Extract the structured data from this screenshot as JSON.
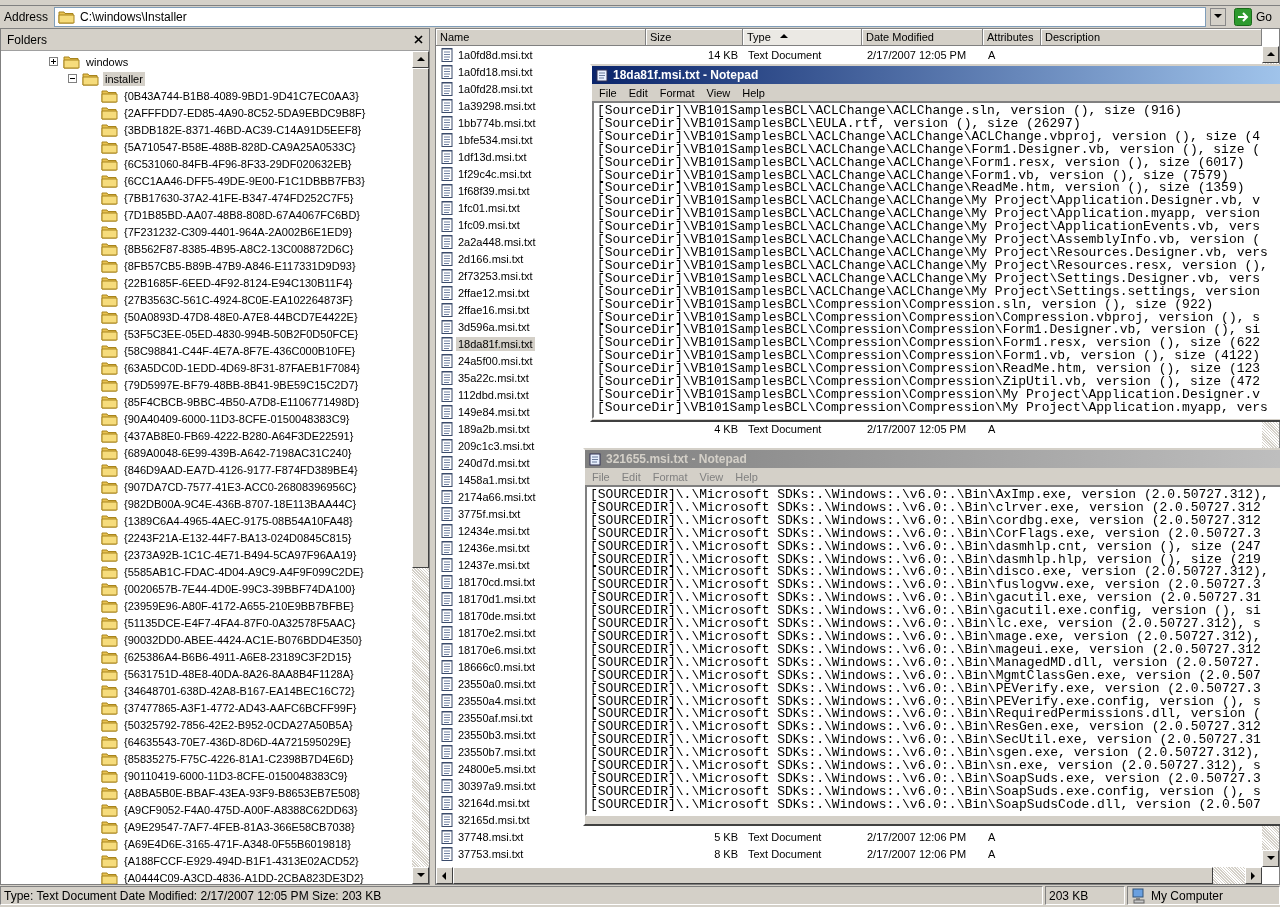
{
  "address_bar": {
    "label": "Address",
    "value": "C:\\windows\\Installer",
    "go_label": "Go"
  },
  "folders_pane": {
    "title": "Folders",
    "tree": [
      {
        "label": "windows",
        "expanded": false,
        "selected": false,
        "children": [
          {
            "label": "installer",
            "expanded": true,
            "selected": true,
            "children": [
              {
                "label": "{0B43A744-B1B8-4089-9BD1-9D41C7EC0AA3}",
                "selected": false
              },
              {
                "label": "{2AFFFDD7-ED85-4A90-8C52-5DA9EBDC9B8F}",
                "selected": false
              },
              {
                "label": "{3BDB182E-8371-46BD-AC39-C14A91D5EEF8}",
                "selected": false
              },
              {
                "label": "{5A710547-B58E-488B-828D-CA9A25A0533C}",
                "selected": false
              },
              {
                "label": "{6C531060-84FB-4F96-8F33-29DF020632EB}",
                "selected": false
              },
              {
                "label": "{6CC1AA46-DFF5-49DE-9E00-F1C1DBBB7FB3}",
                "selected": false
              },
              {
                "label": "{7BB17630-37A2-41FE-B347-474FD252C7F5}",
                "selected": false
              },
              {
                "label": "{7D1B85BD-AA07-48B8-808D-67A4067FC6BD}",
                "selected": false
              },
              {
                "label": "{7F231232-C309-4401-964A-2A002B6E1ED9}",
                "selected": false
              },
              {
                "label": "{8B562F87-8385-4B95-A8C2-13C008872D6C}",
                "selected": false
              },
              {
                "label": "{8FB57CB5-B89B-47B9-A846-E117331D9D93}",
                "selected": false
              },
              {
                "label": "{22B1685F-6EED-4F92-8124-E94C130B11F4}",
                "selected": false
              },
              {
                "label": "{27B3563C-561C-4924-8C0E-EA102264873F}",
                "selected": false
              },
              {
                "label": "{50A0893D-47D8-48E0-A7E8-44BCD7E4422E}",
                "selected": false
              },
              {
                "label": "{53F5C3EE-05ED-4830-994B-50B2F0D50FCE}",
                "selected": false
              },
              {
                "label": "{58C98841-C44F-4E7A-8F7E-436C000B10FE}",
                "selected": false
              },
              {
                "label": "{63A5DC0D-1EDD-4D69-8F31-87FAEB1F7084}",
                "selected": false
              },
              {
                "label": "{79D5997E-BF79-48BB-8B41-9BE59C15C2D7}",
                "selected": false
              },
              {
                "label": "{85F4CBCB-9BBC-4B50-A7D8-E1106771498D}",
                "selected": false
              },
              {
                "label": "{90A40409-6000-11D3-8CFE-0150048383C9}",
                "selected": false
              },
              {
                "label": "{437AB8E0-FB69-4222-B280-A64F3DE22591}",
                "selected": false
              },
              {
                "label": "{689A0048-6E99-439B-A642-7198AC31C240}",
                "selected": false
              },
              {
                "label": "{846D9AAD-EA7D-4126-9177-F874FD389BE4}",
                "selected": false
              },
              {
                "label": "{907DA7CD-7577-41E3-ACC0-26808396956C}",
                "selected": false
              },
              {
                "label": "{982DB00A-9C4E-436B-8707-18E113BAA44C}",
                "selected": false
              },
              {
                "label": "{1389C6A4-4965-4AEC-9175-08B54A10FA48}",
                "selected": false
              },
              {
                "label": "{2243F21A-E132-44F7-BA13-024D0845C815}",
                "selected": false
              },
              {
                "label": "{2373A92B-1C1C-4E71-B494-5CA97F96AA19}",
                "selected": false
              },
              {
                "label": "{5585AB1C-FDAC-4D04-A9C9-A4F9F099C2DE}",
                "selected": false
              },
              {
                "label": "{0020657B-7E44-4D0E-99C3-39BBF74DA100}",
                "selected": false
              },
              {
                "label": "{23959E96-A80F-4172-A655-210E9BB7BFBE}",
                "selected": false
              },
              {
                "label": "{51135DCE-E4F7-4FA4-87F0-0A32578F5AAC}",
                "selected": false
              },
              {
                "label": "{90032DD0-ABEE-4424-AC1E-B076BDD4E350}",
                "selected": false
              },
              {
                "label": "{625386A4-B6B6-4911-A6E8-23189C3F2D15}",
                "selected": false
              },
              {
                "label": "{5631751D-48E8-40DA-8A26-8AA8B4F1128A}",
                "selected": false
              },
              {
                "label": "{34648701-638D-42A8-B167-EA14BEC16C72}",
                "selected": false
              },
              {
                "label": "{37477865-A3F1-4772-AD43-AAFC6BCFF99F}",
                "selected": false
              },
              {
                "label": "{50325792-7856-42E2-B952-0CDA27A50B5A}",
                "selected": false
              },
              {
                "label": "{64635543-70E7-436D-8D6D-4A721595029E}",
                "selected": false
              },
              {
                "label": "{85835275-F75C-4226-81A1-C2398B7D4E6D}",
                "selected": false
              },
              {
                "label": "{90110419-6000-11D3-8CFE-0150048383C9}",
                "selected": false
              },
              {
                "label": "{A8BA5B0E-BBAF-43EA-93F9-B8653EB7E508}",
                "selected": false
              },
              {
                "label": "{A9CF9052-F4A0-475D-A00F-A8388C62DD63}",
                "selected": false
              },
              {
                "label": "{A9E29547-7AF7-4FEB-81A3-366E58CB7038}",
                "selected": false
              },
              {
                "label": "{A69E4D6E-3165-471F-A348-0F55B6019818}",
                "selected": false
              },
              {
                "label": "{A188FCCF-E929-494D-B1F1-4313E02ACD52}",
                "selected": false
              },
              {
                "label": "{A0444C09-A3CD-4836-A1DD-2CBA823DE3D2}",
                "selected": false
              }
            ]
          }
        ]
      }
    ]
  },
  "file_list": {
    "columns": [
      {
        "label": "Name",
        "sorted": false
      },
      {
        "label": "Size",
        "sorted": false
      },
      {
        "label": "Type",
        "sorted": true
      },
      {
        "label": "Date Modified",
        "sorted": false
      },
      {
        "label": "Attributes",
        "sorted": false
      },
      {
        "label": "Description",
        "sorted": false
      }
    ],
    "rows": [
      {
        "name": "1a0fd8d.msi.txt",
        "selected": false,
        "size": "14 KB",
        "type": "Text Document",
        "modified": "2/17/2007 12:05 PM",
        "attributes": "A"
      },
      {
        "name": "1a0fd18.msi.txt",
        "selected": false
      },
      {
        "name": "1a0fd28.msi.txt",
        "selected": false
      },
      {
        "name": "1a39298.msi.txt",
        "selected": false
      },
      {
        "name": "1bb774b.msi.txt",
        "selected": false
      },
      {
        "name": "1bfe534.msi.txt",
        "selected": false
      },
      {
        "name": "1df13d.msi.txt",
        "selected": false
      },
      {
        "name": "1f29c4c.msi.txt",
        "selected": false
      },
      {
        "name": "1f68f39.msi.txt",
        "selected": false
      },
      {
        "name": "1fc01.msi.txt",
        "selected": false
      },
      {
        "name": "1fc09.msi.txt",
        "selected": false
      },
      {
        "name": "2a2a448.msi.txt",
        "selected": false
      },
      {
        "name": "2d166.msi.txt",
        "selected": false
      },
      {
        "name": "2f73253.msi.txt",
        "selected": false
      },
      {
        "name": "2ffae12.msi.txt",
        "selected": false
      },
      {
        "name": "2ffae16.msi.txt",
        "selected": false
      },
      {
        "name": "3d596a.msi.txt",
        "selected": false
      },
      {
        "name": "18da81f.msi.txt",
        "selected": true
      },
      {
        "name": "24a5f00.msi.txt",
        "selected": false
      },
      {
        "name": "35a22c.msi.txt",
        "selected": false
      },
      {
        "name": "112dbd.msi.txt",
        "selected": false
      },
      {
        "name": "149e84.msi.txt",
        "selected": false
      },
      {
        "name": "189a2b.msi.txt",
        "selected": false,
        "size": "4 KB",
        "type": "Text Document",
        "modified": "2/17/2007 12:05 PM",
        "attributes": "A"
      },
      {
        "name": "209c1c3.msi.txt",
        "selected": false
      },
      {
        "name": "240d7d.msi.txt",
        "selected": false
      },
      {
        "name": "1458a1.msi.txt",
        "selected": false
      },
      {
        "name": "2174a66.msi.txt",
        "selected": false
      },
      {
        "name": "3775f.msi.txt",
        "selected": false
      },
      {
        "name": "12434e.msi.txt",
        "selected": false
      },
      {
        "name": "12436e.msi.txt",
        "selected": false
      },
      {
        "name": "12437e.msi.txt",
        "selected": false
      },
      {
        "name": "18170cd.msi.txt",
        "selected": false
      },
      {
        "name": "18170d1.msi.txt",
        "selected": false
      },
      {
        "name": "18170de.msi.txt",
        "selected": false
      },
      {
        "name": "18170e2.msi.txt",
        "selected": false
      },
      {
        "name": "18170e6.msi.txt",
        "selected": false
      },
      {
        "name": "18666c0.msi.txt",
        "selected": false
      },
      {
        "name": "23550a0.msi.txt",
        "selected": false
      },
      {
        "name": "23550a4.msi.txt",
        "selected": false
      },
      {
        "name": "23550af.msi.txt",
        "selected": false
      },
      {
        "name": "23550b3.msi.txt",
        "selected": false
      },
      {
        "name": "23550b7.msi.txt",
        "selected": false
      },
      {
        "name": "24800e5.msi.txt",
        "selected": false
      },
      {
        "name": "30397a9.msi.txt",
        "selected": false
      },
      {
        "name": "32164d.msi.txt",
        "selected": false
      },
      {
        "name": "32165d.msi.txt",
        "selected": false
      },
      {
        "name": "37748.msi.txt",
        "selected": false,
        "size": "5 KB",
        "type": "Text Document",
        "modified": "2/17/2007 12:06 PM",
        "attributes": "A"
      },
      {
        "name": "37753.msi.txt",
        "selected": false,
        "size": "8 KB",
        "type": "Text Document",
        "modified": "2/17/2007 12:06 PM",
        "attributes": "A"
      }
    ]
  },
  "notepads": [
    {
      "title": "18da81f.msi.txt - Notepad",
      "active": true,
      "menu": [
        "File",
        "Edit",
        "Format",
        "View",
        "Help"
      ],
      "lines": [
        "[SourceDir]\\VB101SamplesBCL\\ACLChange\\ACLChange.sln, version (), size (916)",
        "[SourceDir]\\VB101SamplesBCL\\EULA.rtf, version (), size (26297)",
        "[SourceDir]\\VB101SamplesBCL\\ACLChange\\ACLChange\\ACLChange.vbproj, version (), size (4",
        "[SourceDir]\\VB101SamplesBCL\\ACLChange\\ACLChange\\Form1.Designer.vb, version (), size (",
        "[SourceDir]\\VB101SamplesBCL\\ACLChange\\ACLChange\\Form1.resx, version (), size (6017)",
        "[SourceDir]\\VB101SamplesBCL\\ACLChange\\ACLChange\\Form1.vb, version (), size (7579)",
        "[SourceDir]\\VB101SamplesBCL\\ACLChange\\ACLChange\\ReadMe.htm, version (), size (1359)",
        "[SourceDir]\\VB101SamplesBCL\\ACLChange\\ACLChange\\My Project\\Application.Designer.vb, v",
        "[SourceDir]\\VB101SamplesBCL\\ACLChange\\ACLChange\\My Project\\Application.myapp, version",
        "[SourceDir]\\VB101SamplesBCL\\ACLChange\\ACLChange\\My Project\\ApplicationEvents.vb, vers",
        "[SourceDir]\\VB101SamplesBCL\\ACLChange\\ACLChange\\My Project\\AssemblyInfo.vb, version (",
        "[SourceDir]\\VB101SamplesBCL\\ACLChange\\ACLChange\\My Project\\Resources.Designer.vb, vers",
        "[SourceDir]\\VB101SamplesBCL\\ACLChange\\ACLChange\\My Project\\Resources.resx, version (),",
        "[SourceDir]\\VB101SamplesBCL\\ACLChange\\ACLChange\\My Project\\Settings.Designer.vb, vers",
        "[SourceDir]\\VB101SamplesBCL\\ACLChange\\ACLChange\\My Project\\Settings.settings, version",
        "[SourceDir]\\VB101SamplesBCL\\Compression\\Compression.sln, version (), size (922)",
        "[SourceDir]\\VB101SamplesBCL\\Compression\\Compression\\Compression.vbproj, version (), s",
        "[SourceDir]\\VB101SamplesBCL\\Compression\\Compression\\Form1.Designer.vb, version (), si",
        "[SourceDir]\\VB101SamplesBCL\\Compression\\Compression\\Form1.resx, version (), size (622",
        "[SourceDir]\\VB101SamplesBCL\\Compression\\Compression\\Form1.vb, version (), size (4122)",
        "[SourceDir]\\VB101SamplesBCL\\Compression\\Compression\\ReadMe.htm, version (), size (123",
        "[SourceDir]\\VB101SamplesBCL\\Compression\\Compression\\ZipUtil.vb, version (), size (472",
        "[SourceDir]\\VB101SamplesBCL\\Compression\\Compression\\My Project\\Application.Designer.v",
        "[SourceDir]\\VB101SamplesBCL\\Compression\\Compression\\My Project\\Application.myapp, vers"
      ]
    },
    {
      "title": "321655.msi.txt - Notepad",
      "active": false,
      "menu": [
        "File",
        "Edit",
        "Format",
        "View",
        "Help"
      ],
      "lines": [
        "[SOURCEDIR]\\.\\Microsoft SDKs:.\\Windows:.\\v6.0:.\\Bin\\AxImp.exe, version (2.0.50727.312),",
        "[SOURCEDIR]\\.\\Microsoft SDKs:.\\Windows:.\\v6.0:.\\Bin\\clrver.exe, version (2.0.50727.312",
        "[SOURCEDIR]\\.\\Microsoft SDKs:.\\Windows:.\\v6.0:.\\Bin\\cordbg.exe, version (2.0.50727.312",
        "[SOURCEDIR]\\.\\Microsoft SDKs:.\\Windows:.\\v6.0:.\\Bin\\CorFlags.exe, version (2.0.50727.3",
        "[SOURCEDIR]\\.\\Microsoft SDKs:.\\Windows:.\\v6.0:.\\Bin\\dasmhlp.cnt, version (), size (247",
        "[SOURCEDIR]\\.\\Microsoft SDKs:.\\Windows:.\\v6.0:.\\Bin\\dasmhlp.hlp, version (), size (219",
        "[SOURCEDIR]\\.\\Microsoft SDKs:.\\Windows:.\\v6.0:.\\Bin\\disco.exe, version (2.0.50727.312),",
        "[SOURCEDIR]\\.\\Microsoft SDKs:.\\Windows:.\\v6.0:.\\Bin\\fuslogvw.exe, version (2.0.50727.3",
        "[SOURCEDIR]\\.\\Microsoft SDKs:.\\Windows:.\\v6.0:.\\Bin\\gacutil.exe, version (2.0.50727.31",
        "[SOURCEDIR]\\.\\Microsoft SDKs:.\\Windows:.\\v6.0:.\\Bin\\gacutil.exe.config, version (), si",
        "[SOURCEDIR]\\.\\Microsoft SDKs:.\\Windows:.\\v6.0:.\\Bin\\lc.exe, version (2.0.50727.312), s",
        "[SOURCEDIR]\\.\\Microsoft SDKs:.\\Windows:.\\v6.0:.\\Bin\\mage.exe, version (2.0.50727.312),",
        "[SOURCEDIR]\\.\\Microsoft SDKs:.\\Windows:.\\v6.0:.\\Bin\\mageui.exe, version (2.0.50727.312",
        "[SOURCEDIR]\\.\\Microsoft SDKs:.\\Windows:.\\v6.0:.\\Bin\\ManagedMD.dll, version (2.0.50727.",
        "[SOURCEDIR]\\.\\Microsoft SDKs:.\\Windows:.\\v6.0:.\\Bin\\MgmtClassGen.exe, version (2.0.507",
        "[SOURCEDIR]\\.\\Microsoft SDKs:.\\Windows:.\\v6.0:.\\Bin\\PEVerify.exe, version (2.0.50727.3",
        "[SOURCEDIR]\\.\\Microsoft SDKs:.\\Windows:.\\v6.0:.\\Bin\\PEVerify.exe.config, version (), s",
        "[SOURCEDIR]\\.\\Microsoft SDKs:.\\Windows:.\\v6.0:.\\Bin\\RequiredPermissions.dll, version (",
        "[SOURCEDIR]\\.\\Microsoft SDKs:.\\Windows:.\\v6.0:.\\Bin\\ResGen.exe, version (2.0.50727.312",
        "[SOURCEDIR]\\.\\Microsoft SDKs:.\\Windows:.\\v6.0:.\\Bin\\SecUtil.exe, version (2.0.50727.31",
        "[SOURCEDIR]\\.\\Microsoft SDKs:.\\Windows:.\\v6.0:.\\Bin\\sgen.exe, version (2.0.50727.312),",
        "[SOURCEDIR]\\.\\Microsoft SDKs:.\\Windows:.\\v6.0:.\\Bin\\sn.exe, version (2.0.50727.312), s",
        "[SOURCEDIR]\\.\\Microsoft SDKs:.\\Windows:.\\v6.0:.\\Bin\\SoapSuds.exe, version (2.0.50727.3",
        "[SOURCEDIR]\\.\\Microsoft SDKs:.\\Windows:.\\v6.0:.\\Bin\\SoapSuds.exe.config, version (), s",
        "[SOURCEDIR]\\.\\Microsoft SDKs:.\\Windows:.\\v6.0:.\\Bin\\SoapSudsCode.dll, version (2.0.507"
      ]
    }
  ],
  "status_bar": {
    "text": "Type: Text Document Date Modified: 2/17/2007 12:05 PM Size: 203 KB",
    "size": "203 KB",
    "zone": "My Computer"
  }
}
